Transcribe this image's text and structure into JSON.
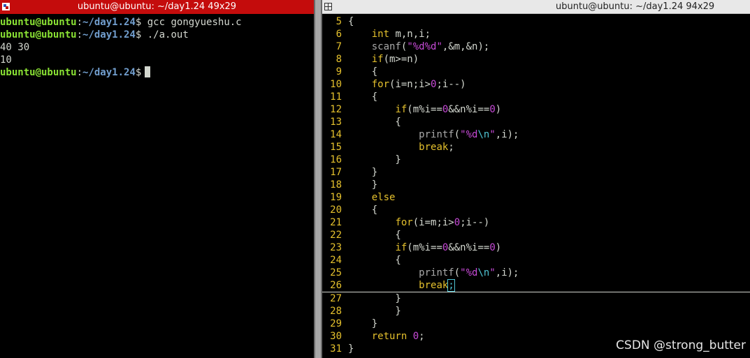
{
  "left_window": {
    "title": "ubuntu@ubuntu: ~/day1.24 49x29",
    "prompt": {
      "user": "ubuntu@ubuntu",
      "sep": ":",
      "dir": "~/day1.24",
      "dollar": "$"
    },
    "lines": [
      {
        "type": "cmd",
        "cmd": " gcc gongyueshu.c"
      },
      {
        "type": "cmd",
        "cmd": " ./a.out"
      },
      {
        "type": "out",
        "text": "40 30"
      },
      {
        "type": "out",
        "text": "10"
      },
      {
        "type": "cmd",
        "cmd": " ",
        "cursor": true
      }
    ]
  },
  "right_window": {
    "title": "ubuntu@ubuntu: ~/day1.24 94x29",
    "code_lines": [
      {
        "n": "5",
        "tokens": [
          [
            "c-text",
            "{"
          ]
        ]
      },
      {
        "n": "6",
        "tokens": [
          [
            "c-text",
            "    "
          ],
          [
            "c-kw",
            "int"
          ],
          [
            "c-text",
            " m,n,i;"
          ]
        ]
      },
      {
        "n": "7",
        "tokens": [
          [
            "c-text",
            "    "
          ],
          [
            "c-fn",
            "scanf"
          ],
          [
            "c-text",
            "("
          ],
          [
            "c-str",
            "\"%d%d\""
          ],
          [
            "c-text",
            ",&m,&n);"
          ]
        ]
      },
      {
        "n": "8",
        "tokens": [
          [
            "c-text",
            "    "
          ],
          [
            "c-kw",
            "if"
          ],
          [
            "c-text",
            "(m>=n)"
          ]
        ]
      },
      {
        "n": "9",
        "tokens": [
          [
            "c-text",
            "    {"
          ]
        ]
      },
      {
        "n": "10",
        "tokens": [
          [
            "c-text",
            "    "
          ],
          [
            "c-kw",
            "for"
          ],
          [
            "c-text",
            "(i=n;i>"
          ],
          [
            "c-num",
            "0"
          ],
          [
            "c-text",
            ";i--)"
          ]
        ]
      },
      {
        "n": "11",
        "tokens": [
          [
            "c-text",
            "    {"
          ]
        ]
      },
      {
        "n": "12",
        "tokens": [
          [
            "c-text",
            "        "
          ],
          [
            "c-kw",
            "if"
          ],
          [
            "c-text",
            "(m%i=="
          ],
          [
            "c-num",
            "0"
          ],
          [
            "c-text",
            "&&n%i=="
          ],
          [
            "c-num",
            "0"
          ],
          [
            "c-text",
            ")"
          ]
        ]
      },
      {
        "n": "13",
        "tokens": [
          [
            "c-text",
            "        {"
          ]
        ]
      },
      {
        "n": "14",
        "tokens": [
          [
            "c-text",
            "            "
          ],
          [
            "c-fn",
            "printf"
          ],
          [
            "c-text",
            "("
          ],
          [
            "c-str",
            "\"%d"
          ],
          [
            "c-esc",
            "\\n"
          ],
          [
            "c-str",
            "\""
          ],
          [
            "c-text",
            ",i);"
          ]
        ]
      },
      {
        "n": "15",
        "tokens": [
          [
            "c-text",
            "            "
          ],
          [
            "c-kw",
            "break"
          ],
          [
            "c-text",
            ";"
          ]
        ]
      },
      {
        "n": "16",
        "tokens": [
          [
            "c-text",
            "        }"
          ]
        ]
      },
      {
        "n": "17",
        "tokens": [
          [
            "c-text",
            "    }"
          ]
        ]
      },
      {
        "n": "18",
        "tokens": [
          [
            "c-text",
            "    }"
          ]
        ]
      },
      {
        "n": "19",
        "tokens": [
          [
            "c-text",
            "    "
          ],
          [
            "c-kw",
            "else"
          ]
        ]
      },
      {
        "n": "20",
        "tokens": [
          [
            "c-text",
            "    {"
          ]
        ]
      },
      {
        "n": "21",
        "tokens": [
          [
            "c-text",
            "        "
          ],
          [
            "c-kw",
            "for"
          ],
          [
            "c-text",
            "(i=m;i>"
          ],
          [
            "c-num",
            "0"
          ],
          [
            "c-text",
            ";i--)"
          ]
        ]
      },
      {
        "n": "22",
        "tokens": [
          [
            "c-text",
            "        {"
          ]
        ]
      },
      {
        "n": "23",
        "tokens": [
          [
            "c-text",
            "        "
          ],
          [
            "c-kw",
            "if"
          ],
          [
            "c-text",
            "(m%i=="
          ],
          [
            "c-num",
            "0"
          ],
          [
            "c-text",
            "&&n%i=="
          ],
          [
            "c-num",
            "0"
          ],
          [
            "c-text",
            ")"
          ]
        ]
      },
      {
        "n": "24",
        "tokens": [
          [
            "c-text",
            "        {"
          ]
        ]
      },
      {
        "n": "25",
        "tokens": [
          [
            "c-text",
            "            "
          ],
          [
            "c-fn",
            "printf"
          ],
          [
            "c-text",
            "("
          ],
          [
            "c-str",
            "\"%d"
          ],
          [
            "c-esc",
            "\\n"
          ],
          [
            "c-str",
            "\""
          ],
          [
            "c-text",
            ",i);"
          ]
        ]
      },
      {
        "n": "26",
        "cursorline": true,
        "tokens": [
          [
            "c-text",
            "            "
          ],
          [
            "c-kw",
            "break"
          ],
          [
            "cursor",
            ";"
          ]
        ]
      },
      {
        "n": "27",
        "tokens": [
          [
            "c-text",
            "        }"
          ]
        ]
      },
      {
        "n": "28",
        "tokens": [
          [
            "c-text",
            "        }"
          ]
        ]
      },
      {
        "n": "29",
        "tokens": [
          [
            "c-text",
            "    }"
          ]
        ]
      },
      {
        "n": "30",
        "tokens": [
          [
            "c-text",
            "    "
          ],
          [
            "c-kw",
            "return"
          ],
          [
            "c-text",
            " "
          ],
          [
            "c-num",
            "0"
          ],
          [
            "c-text",
            ";"
          ]
        ]
      },
      {
        "n": "31",
        "tokens": [
          [
            "c-text",
            "}"
          ]
        ]
      }
    ]
  },
  "watermark": "CSDN @strong_butter",
  "colors": {
    "active_titlebar": "#c40c0c",
    "inactive_titlebar": "#e8e8e8",
    "prompt_user": "#8ae234",
    "prompt_dir": "#729fcf",
    "line_number": "#e5c12d",
    "keyword": "#e5c12d",
    "string": "#c84bd8"
  }
}
